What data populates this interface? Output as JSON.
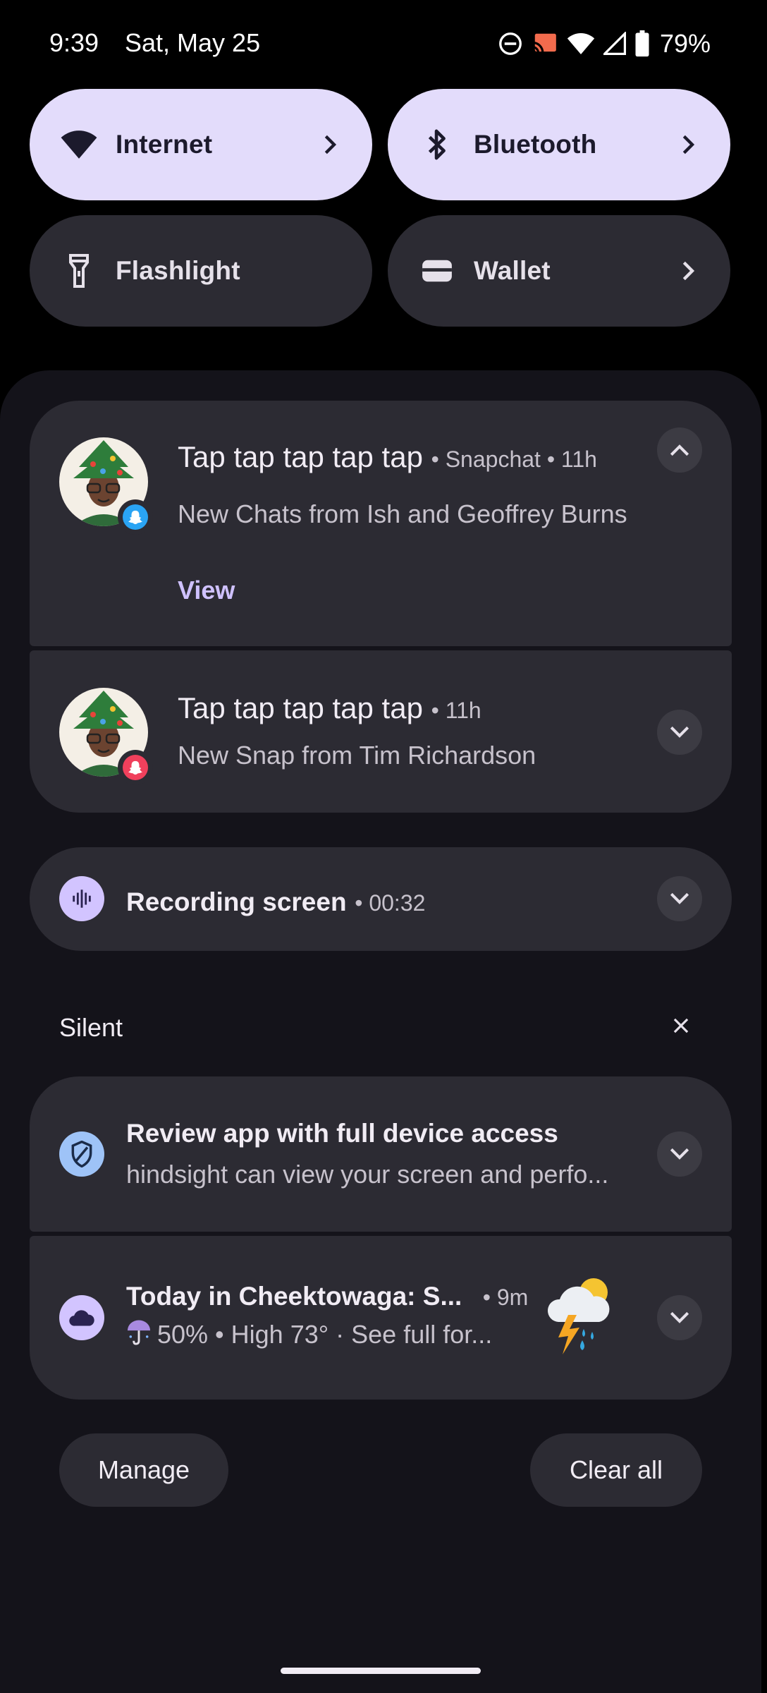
{
  "status_bar": {
    "time": "9:39",
    "date": "Sat, May 25",
    "battery": "79%",
    "icons": [
      "do-not-disturb-icon",
      "cast-icon",
      "wifi-icon",
      "cellular-signal-icon",
      "battery-icon"
    ]
  },
  "quick_settings": {
    "tiles": [
      {
        "label": "Internet",
        "icon": "wifi-icon",
        "active": true,
        "has_chevron": true
      },
      {
        "label": "Bluetooth",
        "icon": "bluetooth-icon",
        "active": true,
        "has_chevron": true
      },
      {
        "label": "Flashlight",
        "icon": "flashlight-icon",
        "active": false,
        "has_chevron": false
      },
      {
        "label": "Wallet",
        "icon": "wallet-icon",
        "active": false,
        "has_chevron": true
      }
    ]
  },
  "notifications": {
    "group": [
      {
        "title": "Tap tap tap tap tap",
        "app": "Snapchat",
        "time": "11h",
        "text": "New Chats from Ish and Geoffrey Burns",
        "action": "View",
        "expanded": true,
        "badge_color": "#2aa4f4"
      },
      {
        "title": "Tap tap tap tap tap",
        "time": "11h",
        "text": "New Snap from Tim Richardson",
        "expanded": false,
        "badge_color": "#f0405c"
      }
    ],
    "recording": {
      "title": "Recording screen",
      "time": "00:32"
    },
    "silent": {
      "label": "Silent",
      "items": [
        {
          "title": "Review app with full device access",
          "text": "hindsight can view your screen and perfo..."
        },
        {
          "title": "Today in Cheektowaga: S...",
          "time": "9m",
          "text": "50% • High 73° · See full for..."
        }
      ]
    },
    "separator": "•"
  },
  "footer": {
    "manage": "Manage",
    "clear_all": "Clear all"
  },
  "colors": {
    "tile_active": "#e3dcfb",
    "tile_inactive": "#2c2b33",
    "card": "#2c2b33",
    "panel": "#14131a",
    "accent": "#cfc1ff"
  }
}
